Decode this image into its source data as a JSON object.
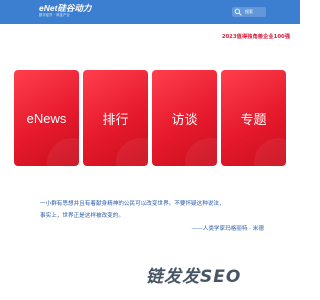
{
  "header": {
    "logo_main": "eNet硅谷动力",
    "logo_sub": "数字经济 · 科技产业",
    "search_label": "搜索"
  },
  "award": "2023值得独角兽企业100强",
  "cards": [
    {
      "label": "eNews"
    },
    {
      "label": "排行"
    },
    {
      "label": "访谈"
    },
    {
      "label": "专题"
    }
  ],
  "quote": {
    "line1": "一小群有思想并且有着献身精神的公民可以改变世界。不要怀疑这种说法，",
    "line2": "事实上，世界正是这样被改变的。",
    "author": "——人类学家玛格丽特 · 米德"
  },
  "watermark": "链发发SEO",
  "colors": {
    "header_bg": "#3c7ed0",
    "card_red": "#e61a2c",
    "award_red": "#d81e3a",
    "quote_blue": "#2a5caa"
  }
}
